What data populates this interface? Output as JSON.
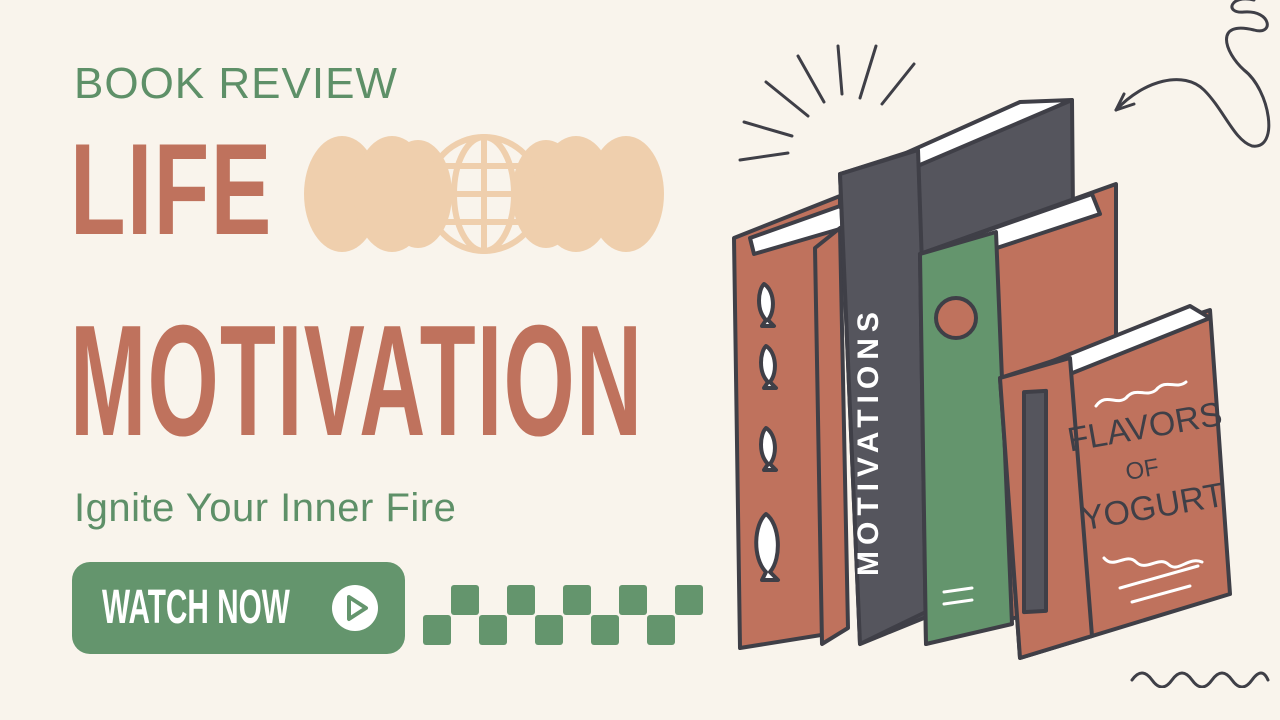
{
  "eyebrow": "BOOK REVIEW",
  "title": {
    "line1": "LIFE",
    "line2": "MOTIVATION"
  },
  "subtitle": "Ignite Your Inner Fire",
  "cta": {
    "label": "WATCH NOW",
    "icon": "play-circle-icon"
  },
  "books": {
    "spine_text": "MOTIVATIONS",
    "cover_lines": [
      "FLAVORS",
      "OF",
      "YOGURT"
    ]
  },
  "colors": {
    "background": "#f9f4ec",
    "terracotta": "#bf725d",
    "green": "#64956d",
    "peach": "#efcfad",
    "charcoal": "#55555d",
    "outline": "#3f3f47"
  }
}
